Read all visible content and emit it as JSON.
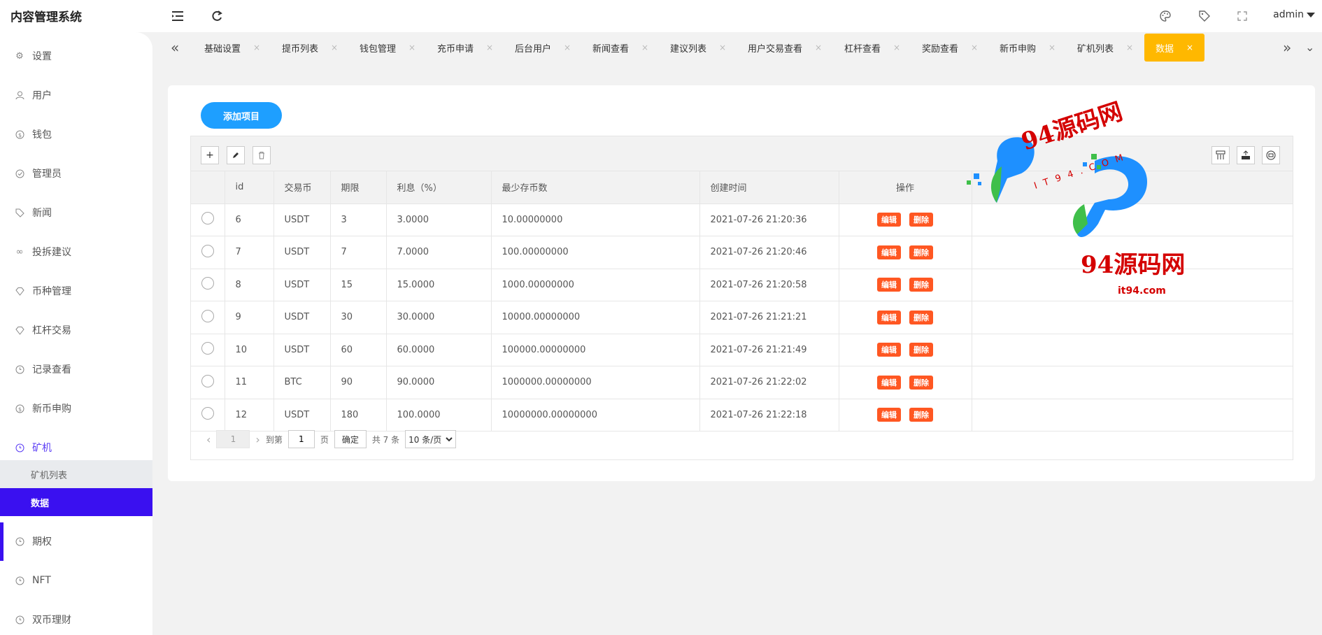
{
  "header": {
    "title": "内容管理系统",
    "user": "admin"
  },
  "sidebar": {
    "items": [
      {
        "label": "设置",
        "icon": "gear-icon"
      },
      {
        "label": "用户",
        "icon": "user-icon"
      },
      {
        "label": "钱包",
        "icon": "coin-icon"
      },
      {
        "label": "管理员",
        "icon": "check-circle-icon"
      },
      {
        "label": "新闻",
        "icon": "tag-icon"
      },
      {
        "label": "投拆建议",
        "icon": "link-icon"
      },
      {
        "label": "币种管理",
        "icon": "diamond-icon"
      },
      {
        "label": "杠杆交易",
        "icon": "diamond-icon"
      },
      {
        "label": "记录查看",
        "icon": "clock-icon"
      },
      {
        "label": "新币申购",
        "icon": "coin-icon"
      },
      {
        "label": "矿机",
        "icon": "clock-icon"
      }
    ],
    "subitems": [
      {
        "label": "矿机列表"
      },
      {
        "label": "数据"
      }
    ],
    "bottom_items": [
      {
        "label": "期权",
        "icon": "clock-icon"
      },
      {
        "label": "NFT",
        "icon": "clock-icon"
      },
      {
        "label": "双币理财",
        "icon": "clock-icon"
      }
    ]
  },
  "tabs": [
    {
      "label": "基础设置"
    },
    {
      "label": "提币列表"
    },
    {
      "label": "钱包管理"
    },
    {
      "label": "充币申请"
    },
    {
      "label": "后台用户"
    },
    {
      "label": "新闻查看"
    },
    {
      "label": "建议列表"
    },
    {
      "label": "用户交易查看"
    },
    {
      "label": "杠杆查看"
    },
    {
      "label": "奖励查看"
    },
    {
      "label": "新币申购"
    },
    {
      "label": "矿机列表"
    },
    {
      "label": "数据"
    }
  ],
  "tab_close_glyph": "×",
  "main": {
    "add_button": "添加项目",
    "columns": [
      "id",
      "交易币",
      "期限",
      "利息（%）",
      "最少存币数",
      "创建时间",
      "操作"
    ],
    "rows": [
      {
        "id": "6",
        "coin": "USDT",
        "term": "3",
        "interest": "3.0000",
        "min": "10.00000000",
        "created": "2021-07-26 21:20:36"
      },
      {
        "id": "7",
        "coin": "USDT",
        "term": "7",
        "interest": "7.0000",
        "min": "100.00000000",
        "created": "2021-07-26 21:20:46"
      },
      {
        "id": "8",
        "coin": "USDT",
        "term": "15",
        "interest": "15.0000",
        "min": "1000.00000000",
        "created": "2021-07-26 21:20:58"
      },
      {
        "id": "9",
        "coin": "USDT",
        "term": "30",
        "interest": "30.0000",
        "min": "10000.00000000",
        "created": "2021-07-26 21:21:21"
      },
      {
        "id": "10",
        "coin": "USDT",
        "term": "60",
        "interest": "60.0000",
        "min": "100000.00000000",
        "created": "2021-07-26 21:21:49"
      },
      {
        "id": "11",
        "coin": "BTC",
        "term": "90",
        "interest": "90.0000",
        "min": "1000000.00000000",
        "created": "2021-07-26 21:22:02"
      },
      {
        "id": "12",
        "coin": "USDT",
        "term": "180",
        "interest": "100.0000",
        "min": "10000000.00000000",
        "created": "2021-07-26 21:22:18"
      }
    ],
    "edit_label": "编辑",
    "delete_label": "删除"
  },
  "pager": {
    "current": "1",
    "goto_label": "到第",
    "goto_value": "1",
    "page_unit": "页",
    "confirm": "确定",
    "total": "共 7 条",
    "page_size": "10 条/页"
  },
  "watermark": {
    "text1": "94源码网",
    "text2": "IT94.COM",
    "text3": "94源码网",
    "text4": "it94.com"
  },
  "colors": {
    "accent": "#3a10f0",
    "active_tab": "#ffb800",
    "primary_button": "#1e9fff",
    "danger": "#ff5722"
  }
}
